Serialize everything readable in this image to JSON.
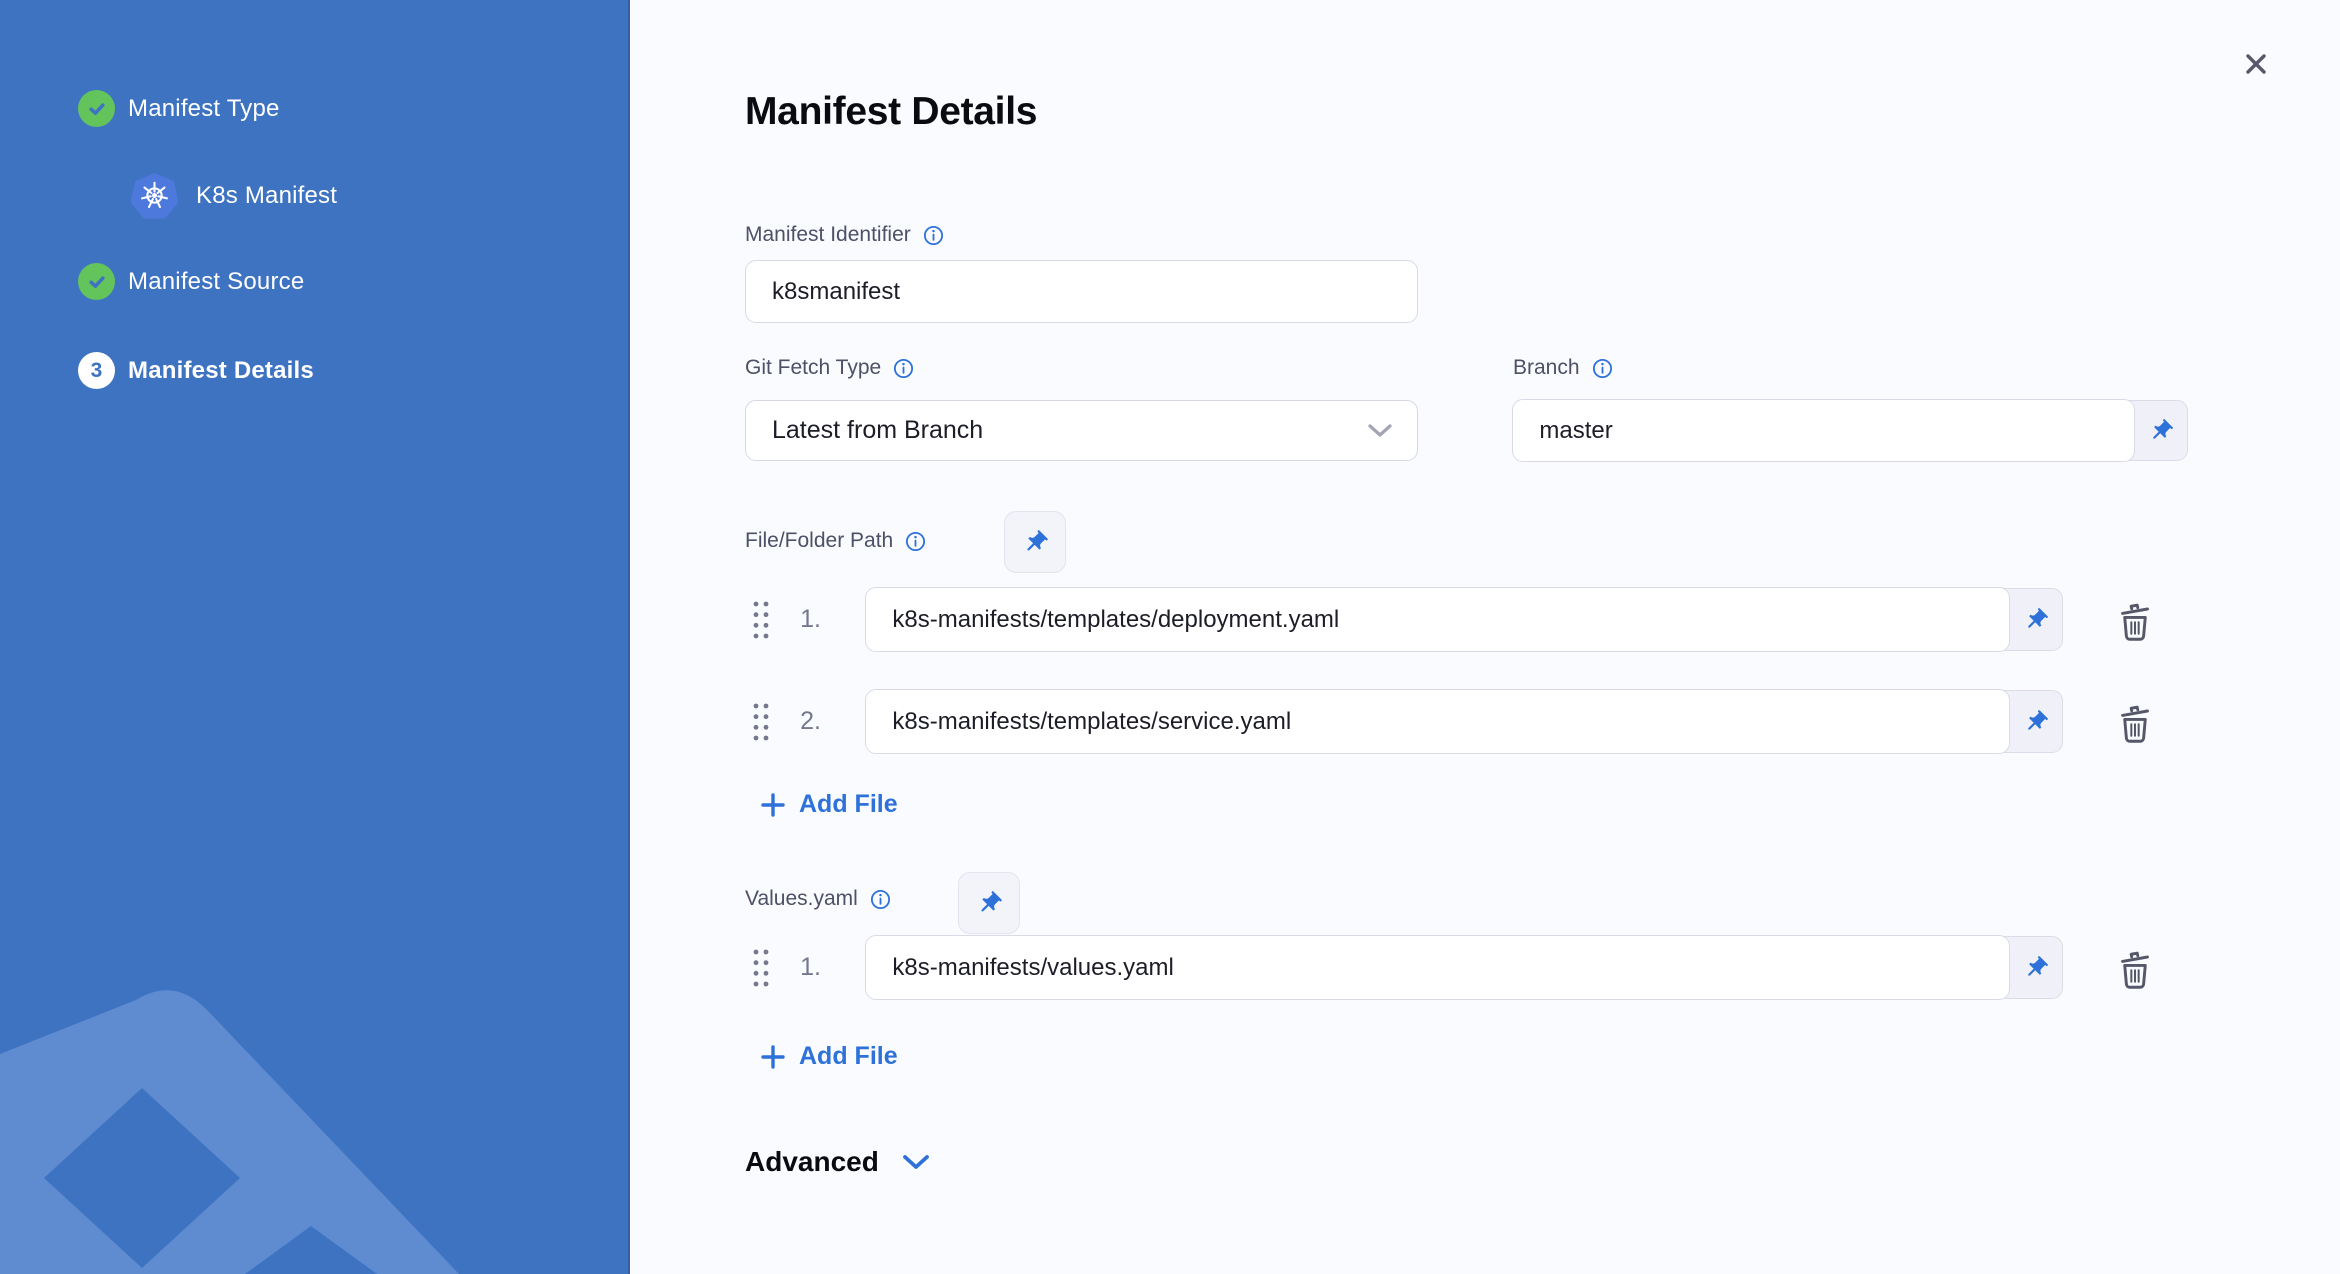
{
  "colors": {
    "sidebar_bg": "#3E73C2",
    "sidebar_watermark": "#5F8BD0",
    "step_complete_green": "#64C45C",
    "content_bg": "#F9FBFE",
    "accent_blue": "#2E71D9",
    "input_border": "#D9DAE6",
    "text_dark": "#1C1D26",
    "label_gray": "#4D5066",
    "icon_gray": "#56586A"
  },
  "sidebar": {
    "steps": [
      {
        "label": "Manifest Type",
        "state": "complete"
      },
      {
        "label": "K8s Manifest",
        "state": "selected-manifest-type"
      },
      {
        "label": "Manifest Source",
        "state": "complete"
      },
      {
        "label": "Manifest Details",
        "state": "active",
        "number": "3"
      }
    ]
  },
  "header": {
    "title": "Manifest Details"
  },
  "main": {
    "manifest_identifier": {
      "label": "Manifest Identifier",
      "value": "k8smanifest"
    },
    "git_fetch_type": {
      "label": "Git Fetch Type",
      "value": "Latest from Branch"
    },
    "branch": {
      "label": "Branch",
      "value": "master"
    },
    "file_folder_path": {
      "label": "File/Folder Path",
      "rows": [
        {
          "index": "1.",
          "value": "k8s-manifests/templates/deployment.yaml"
        },
        {
          "index": "2.",
          "value": "k8s-manifests/templates/service.yaml"
        }
      ],
      "add_label": "Add File"
    },
    "values_yaml": {
      "label": "Values.yaml",
      "rows": [
        {
          "index": "1.",
          "value": "k8s-manifests/values.yaml"
        }
      ],
      "add_label": "Add File"
    },
    "advanced": {
      "label": "Advanced"
    }
  }
}
